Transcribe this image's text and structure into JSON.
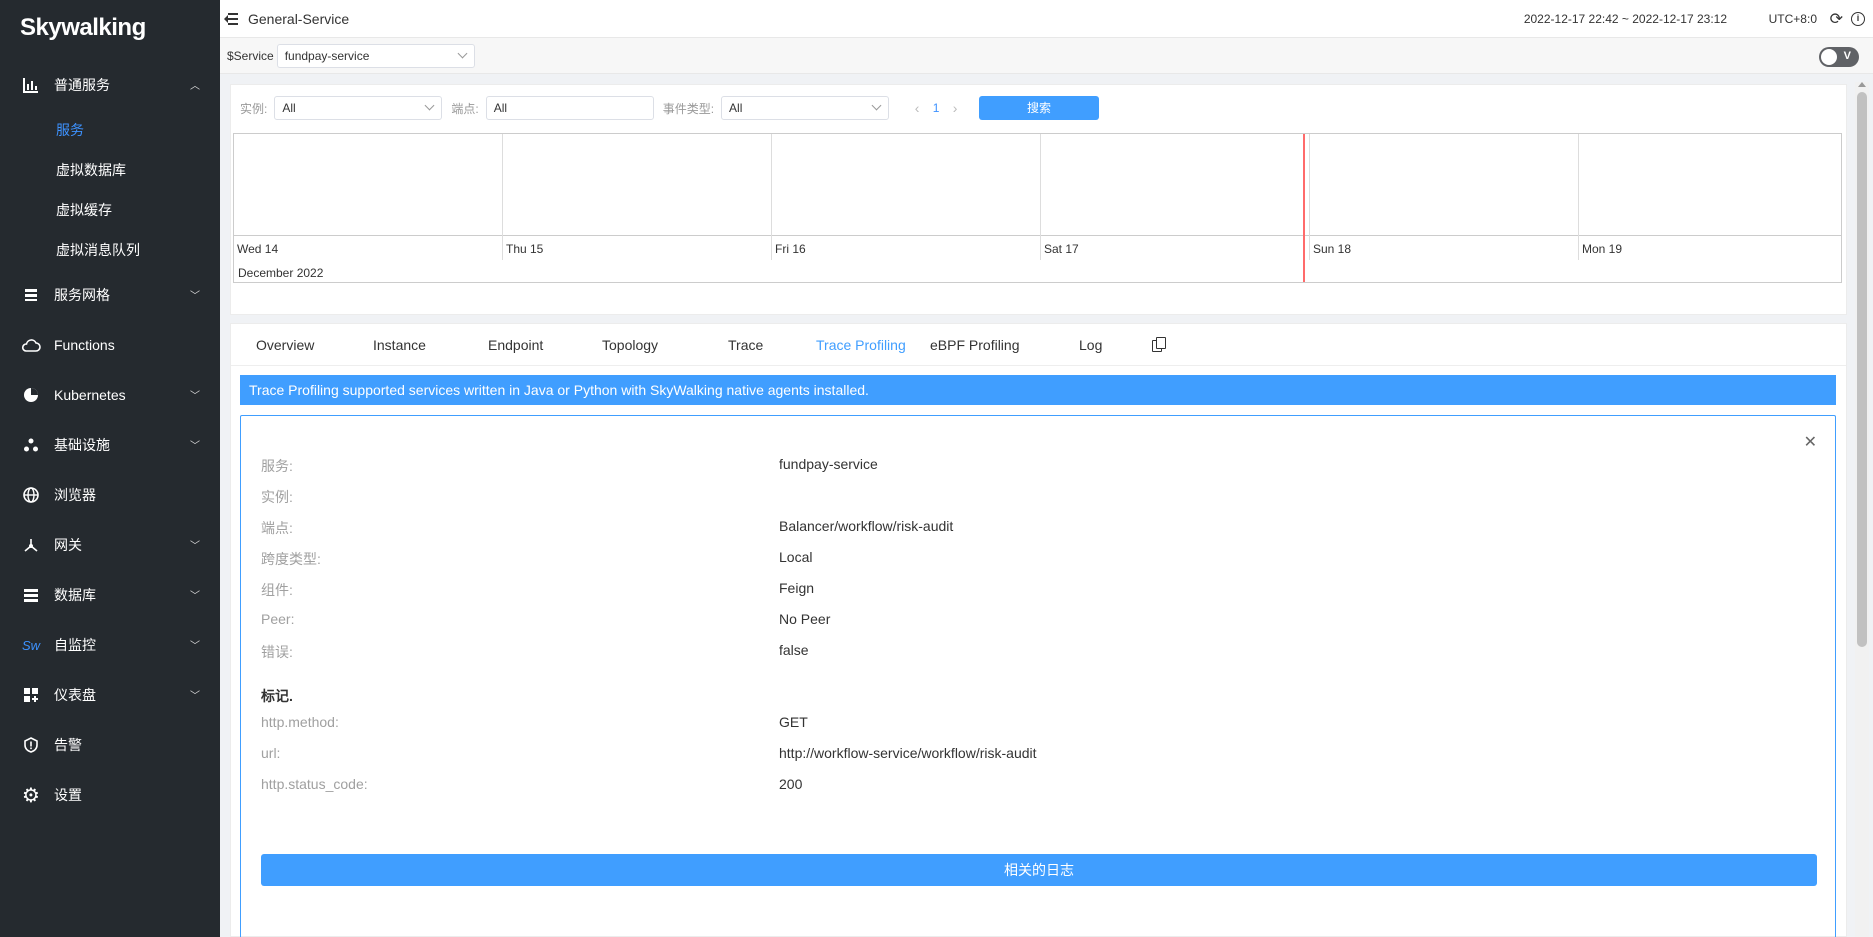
{
  "brand": {
    "logo_text": "Skywalking"
  },
  "sidebar": {
    "items": [
      {
        "label": "普通服务",
        "icon": "bar-chart-icon",
        "expanded": true,
        "children": [
          {
            "label": "服务",
            "active": true
          },
          {
            "label": "虚拟数据库"
          },
          {
            "label": "虚拟缓存"
          },
          {
            "label": "虚拟消息队列"
          }
        ]
      },
      {
        "label": "服务网格",
        "icon": "layers-icon"
      },
      {
        "label": "Functions",
        "icon": "cloud-icon"
      },
      {
        "label": "Kubernetes",
        "icon": "pie-icon"
      },
      {
        "label": "基础设施",
        "icon": "nodes-icon"
      },
      {
        "label": "浏览器",
        "icon": "globe-icon"
      },
      {
        "label": "网关",
        "icon": "gateway-icon"
      },
      {
        "label": "数据库",
        "icon": "database-icon"
      },
      {
        "label": "自监控",
        "icon": "sw-icon",
        "icon_text": "Sw"
      },
      {
        "label": "仪表盘",
        "icon": "dashboard-icon"
      },
      {
        "label": "告警",
        "icon": "alert-icon"
      },
      {
        "label": "设置",
        "icon": "gear-icon"
      }
    ]
  },
  "topbar": {
    "title": "General-Service",
    "time_range": "2022-12-17 22:42 ~ 2022-12-17 23:12",
    "timezone": "UTC+8:0"
  },
  "selector": {
    "label": "$Service",
    "value": "fundpay-service",
    "toggle_text": "V"
  },
  "filters": {
    "instance_label": "实例:",
    "instance_value": "All",
    "endpoint_label": "端点:",
    "endpoint_value": "All",
    "event_type_label": "事件类型:",
    "event_type_value": "All",
    "page": "1",
    "search_label": "搜索"
  },
  "timeline": {
    "days": [
      "Wed 14",
      "Thu 15",
      "Fri 16",
      "Sat 17",
      "Sun 18",
      "Mon 19"
    ],
    "month": "December 2022"
  },
  "tabs": [
    {
      "label": "Overview"
    },
    {
      "label": "Instance"
    },
    {
      "label": "Endpoint"
    },
    {
      "label": "Topology"
    },
    {
      "label": "Trace"
    },
    {
      "label": "Trace Profiling",
      "active": true
    },
    {
      "label": "eBPF Profiling"
    },
    {
      "label": "Log"
    }
  ],
  "banner": "Trace Profiling supported services written in Java or Python with SkyWalking native agents installed.",
  "detail": {
    "fields": [
      {
        "key": "服务:",
        "value": "fundpay-service"
      },
      {
        "key": "实例:",
        "value": ""
      },
      {
        "key": "端点:",
        "value": "Balancer/workflow/risk-audit"
      },
      {
        "key": "跨度类型:",
        "value": "Local"
      },
      {
        "key": "组件:",
        "value": "Feign"
      },
      {
        "key": "Peer:",
        "value": "No Peer"
      },
      {
        "key": "错误:",
        "value": "false"
      }
    ],
    "tags_title": "标记.",
    "tags": [
      {
        "key": "http.method:",
        "value": "GET"
      },
      {
        "key": "url:",
        "value": "http://workflow-service/workflow/risk-audit"
      },
      {
        "key": "http.status_code:",
        "value": "200"
      }
    ],
    "related_logs_label": "相关的日志"
  }
}
